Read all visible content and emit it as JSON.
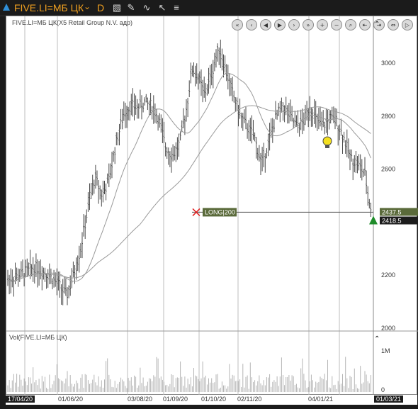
{
  "toolbar": {
    "symbol": "FIVE.LI=МБ ЦК",
    "period": "D",
    "icons": [
      "candlestick-chart-icon",
      "pencil-icon",
      "indicator-icon",
      "cursor-icon",
      "chart-settings-icon"
    ]
  },
  "chart": {
    "title": "FIVE.LI=МБ ЦК(X5 Retail Group N.V. адр)",
    "volume_title": "Vol(FIVE.LI=МБ ЦК)",
    "price_ticks": [
      "3000",
      "2800",
      "2600",
      "2400",
      "2200",
      "2000"
    ],
    "volume_ticks": [
      "1M",
      "0"
    ],
    "date_labels": [
      "17/04/20",
      "01/06/20",
      "03/08/20",
      "01/09/20",
      "01/10/20",
      "02/11/20",
      "04/01/21",
      "01/03/21"
    ],
    "position_label": "LONG|200",
    "price_flag_upper": "2437.5",
    "price_flag_lower": "2418.5",
    "nav_buttons": [
      "first",
      "prev-page",
      "prev",
      "next",
      "next-page",
      "last",
      "zoom-in",
      "zoom-out",
      "zoom-fit",
      "pan-left",
      "pan-right",
      "pan-both",
      "play",
      "collapse"
    ]
  },
  "chart_data": {
    "type": "candlestick",
    "ylim": [
      2000,
      3150
    ],
    "position_price": 2437.5,
    "last_price": 2418.5,
    "colors": {
      "bars": "#4a4a4a",
      "ma": "#9a9a9a",
      "position_line": "#555555",
      "flag": "#5a6a3a",
      "triangle": "#1f8c2a",
      "cross": "#e02020",
      "bulb": "#f4e020"
    }
  }
}
